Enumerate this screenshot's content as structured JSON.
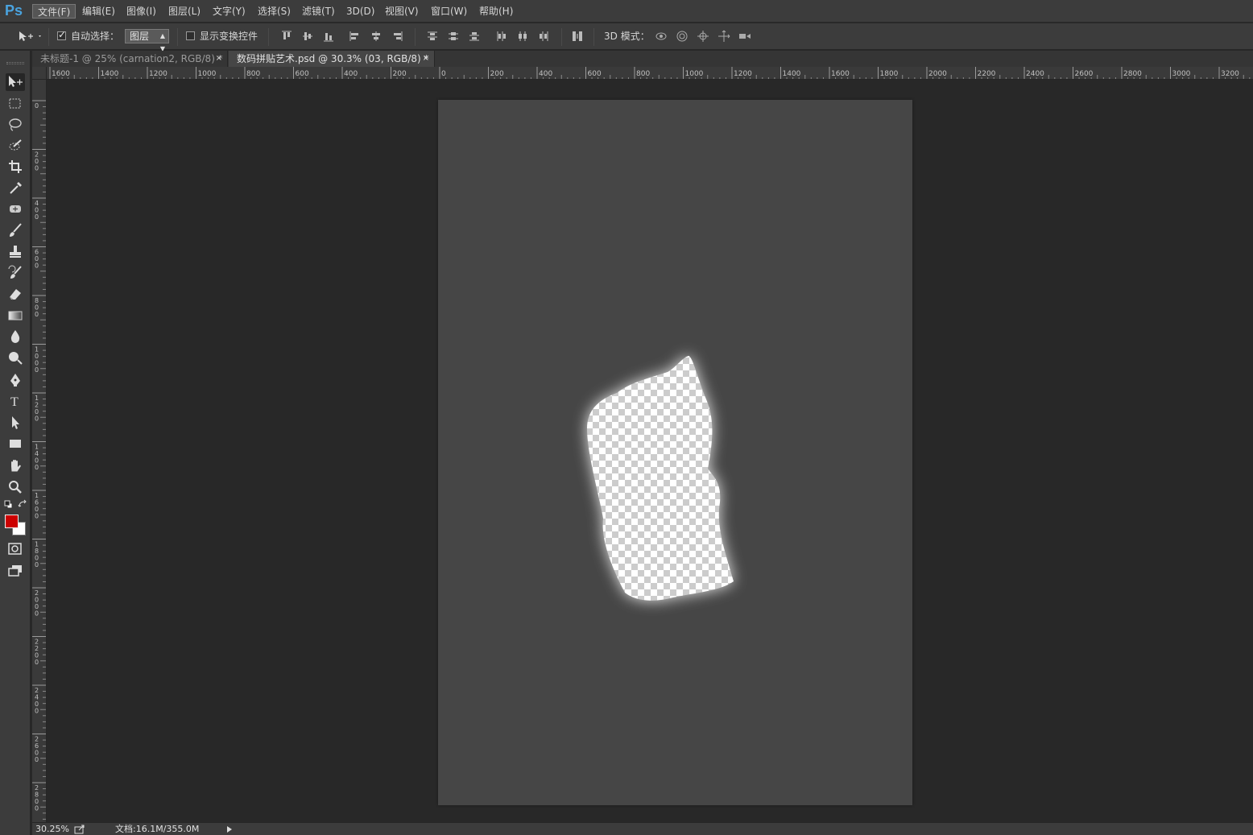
{
  "app": {
    "logo": "Ps"
  },
  "menubar": {
    "items": [
      "文件(F)",
      "编辑(E)",
      "图像(I)",
      "图层(L)",
      "文字(Y)",
      "选择(S)",
      "滤镜(T)",
      "3D(D)",
      "视图(V)",
      "窗口(W)",
      "帮助(H)"
    ],
    "active_index": 0
  },
  "options": {
    "auto_select_label": "自动选择：",
    "auto_select_checked": true,
    "auto_select_target": "图层",
    "show_transform_label": "显示变换控件",
    "show_transform_checked": false,
    "mode_3d_label": "3D 模式："
  },
  "tabs": [
    {
      "label": "未标题-1 @ 25% (carnation2, RGB/8) *",
      "active": false,
      "close": "×"
    },
    {
      "label": "数码拼贴艺术.psd @ 30.3% (03, RGB/8) *",
      "active": true,
      "close": "×"
    }
  ],
  "ruler_h": {
    "labels": [
      "1600",
      "1400",
      "1200",
      "1000",
      "800",
      "600",
      "400",
      "200",
      "0",
      "200",
      "400",
      "600",
      "800",
      "1000",
      "1200",
      "1400",
      "1600",
      "1800",
      "2000",
      "2200",
      "2400",
      "2600",
      "2800",
      "3000",
      "3200"
    ]
  },
  "ruler_v": {
    "labels": [
      "0",
      "200",
      "400",
      "600",
      "800",
      "1000",
      "1200",
      "1400",
      "1600",
      "1800",
      "2000",
      "2200",
      "2400",
      "2600",
      "2800"
    ]
  },
  "tools": [
    "move-tool",
    "marquee-tool",
    "lasso-tool",
    "quick-selection-tool",
    "crop-tool",
    "eyedropper-tool",
    "healing-brush-tool",
    "brush-tool",
    "clone-stamp-tool",
    "history-brush-tool",
    "eraser-tool",
    "gradient-tool",
    "blur-tool",
    "dodge-tool",
    "pen-tool",
    "type-tool",
    "path-selection-tool",
    "rectangle-tool",
    "hand-tool",
    "zoom-tool"
  ],
  "colors": {
    "foreground": "#cc0000",
    "background": "#ffffff",
    "document_bg": "#464646",
    "workspace_bg": "#282828"
  },
  "status": {
    "zoom": "30.25%",
    "doc_info": "文档:16.1M/355.0M"
  }
}
